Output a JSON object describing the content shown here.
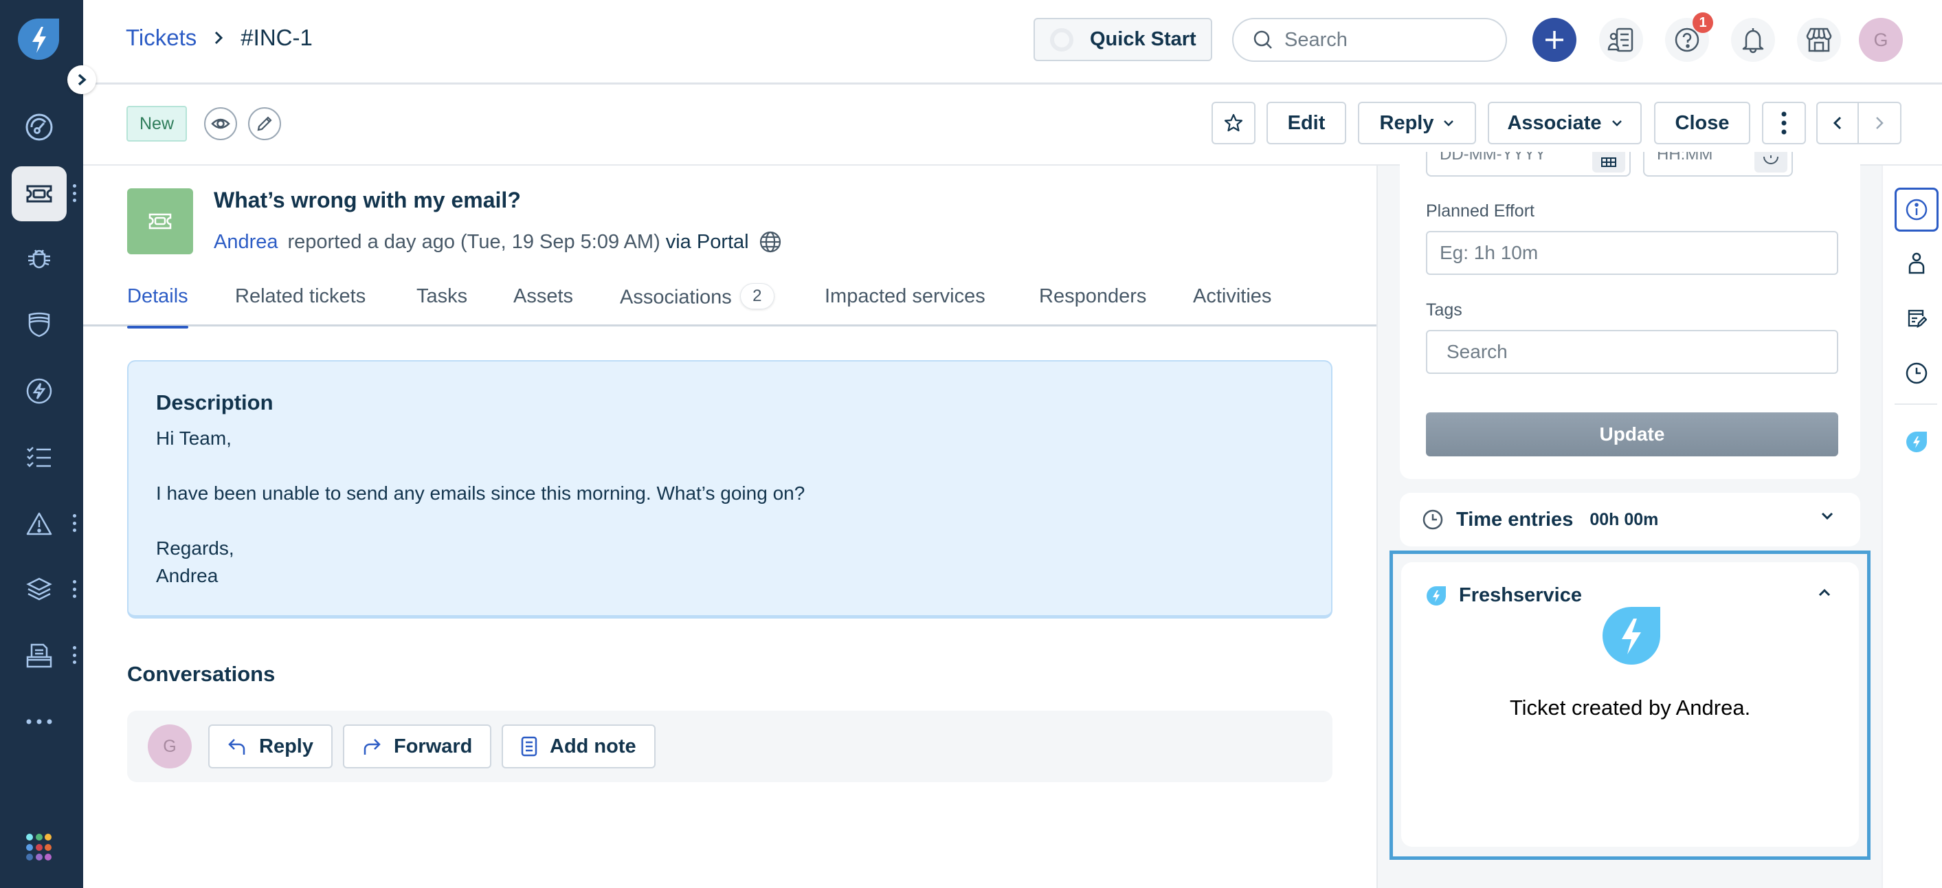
{
  "colors": {
    "sidebar_bg": "#1c3149",
    "accent": "#2c5cc5",
    "status_new_text": "#2f7d5b",
    "badge_red": "#e5564d",
    "freshservice_blue": "#5bc4f5",
    "highlight_border": "#4a9fd5"
  },
  "sidebar": {
    "logo_icon": "freshservice-logo-icon",
    "collapse_icon": "chevron-right-icon",
    "items": [
      {
        "name": "dashboard",
        "icon": "dashboard-gauge-icon",
        "active": false
      },
      {
        "name": "tickets",
        "icon": "ticket-icon",
        "active": true,
        "has_menu": true
      },
      {
        "name": "problems",
        "icon": "bug-icon",
        "active": false
      },
      {
        "name": "changes",
        "icon": "shield-icon",
        "active": false
      },
      {
        "name": "releases",
        "icon": "lightning-icon",
        "active": false
      },
      {
        "name": "tasks",
        "icon": "checklist-icon",
        "active": false
      },
      {
        "name": "alerts",
        "icon": "warning-icon",
        "active": false,
        "has_menu": true
      },
      {
        "name": "assets",
        "icon": "layers-icon",
        "active": false,
        "has_menu": true
      },
      {
        "name": "solutions",
        "icon": "document-tray-icon",
        "active": false,
        "has_menu": true
      },
      {
        "name": "more",
        "icon": "more-horizontal-icon",
        "active": false
      }
    ],
    "apps_icon": "apps-grid-icon",
    "apps_dot_colors": [
      "#7fe7ef",
      "#53b87a",
      "#f5b73d",
      "#5a9de6",
      "#d0464f",
      "#e36a3a",
      "#4472b0",
      "#9a6dcb",
      "#b565c8"
    ]
  },
  "header": {
    "breadcrumb": {
      "parent": "Tickets",
      "separator": "›",
      "current": "#INC-1"
    },
    "quick_start_label": "Quick Start",
    "search_placeholder": "Search",
    "icons": [
      "add-icon",
      "contacts-list-icon",
      "help-icon",
      "bell-icon",
      "marketplace-store-icon"
    ],
    "help_badge_count": "1",
    "avatar_initial": "G"
  },
  "actionbar": {
    "status": "New",
    "watch_icon": "eye-icon",
    "edit_icon": "pencil-icon",
    "star_icon": "star-icon",
    "buttons": {
      "edit": "Edit",
      "reply": "Reply",
      "associate": "Associate",
      "close": "Close"
    },
    "more_icon": "more-vertical-icon",
    "prev_icon": "chevron-left-icon",
    "next_icon": "chevron-right-icon"
  },
  "ticket": {
    "title": "What’s wrong with my email?",
    "requester": "Andrea",
    "reported_text": "reported a day ago (Tue, 19 Sep 5:09 AM)",
    "via": "via Portal",
    "source_icon": "globe-icon"
  },
  "tabs": [
    {
      "label": "Details",
      "active": true
    },
    {
      "label": "Related tickets"
    },
    {
      "label": "Tasks"
    },
    {
      "label": "Assets"
    },
    {
      "label": "Associations",
      "count": "2"
    },
    {
      "label": "Impacted services"
    },
    {
      "label": "Responders"
    },
    {
      "label": "Activities"
    }
  ],
  "description": {
    "title": "Description",
    "lines": [
      "Hi Team,",
      "I have been unable to send any emails since this morning. What’s going on?",
      "Regards,",
      "Andrea"
    ]
  },
  "conversations": {
    "title": "Conversations",
    "avatar_initial": "G",
    "buttons": {
      "reply": "Reply",
      "forward": "Forward",
      "add_note": "Add note"
    }
  },
  "properties": {
    "date_placeholder": "DD-MM-YYYY",
    "time_placeholder": "HH:MM",
    "planned_effort_label": "Planned Effort",
    "planned_effort_placeholder": "Eg: 1h 10m",
    "tags_label": "Tags",
    "tags_placeholder": "Search",
    "update_label": "Update"
  },
  "time_entries": {
    "label": "Time entries",
    "value": "00h 00m"
  },
  "freshservice_widget": {
    "title": "Freshservice",
    "message": "Ticket created by Andrea."
  },
  "rail": {
    "icons": [
      "info-icon",
      "requester-icon",
      "notes-edit-icon",
      "clock-icon",
      "freshservice-app-icon"
    ],
    "active": "info-icon"
  }
}
